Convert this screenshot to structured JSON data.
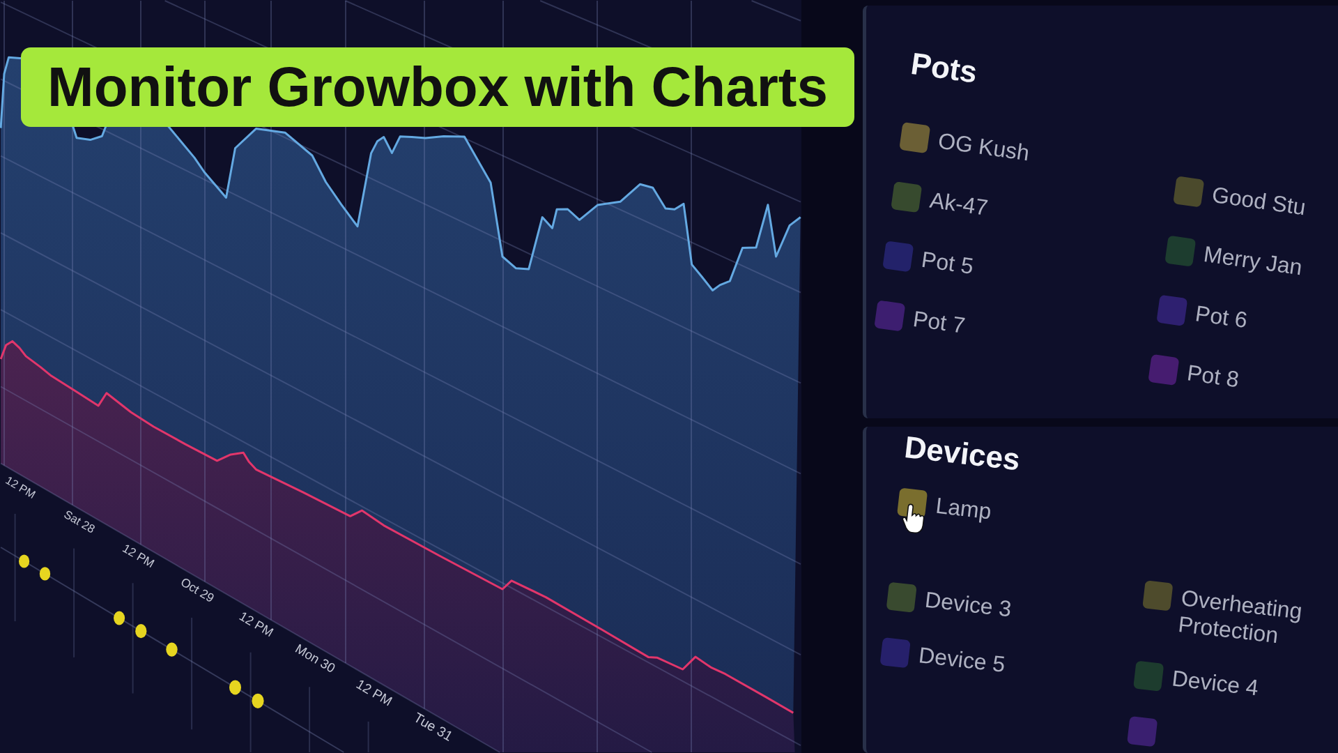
{
  "banner": {
    "title": "Monitor Growbox with Charts"
  },
  "chart": {
    "x_axis_labels": [
      "12 PM",
      "Sat 28",
      "12 PM",
      "Oct 29",
      "12 PM",
      "Mon 30",
      "12 PM",
      "Tue 31"
    ]
  },
  "pots": {
    "title": "Pots",
    "columns": [
      [
        {
          "label": "OG Kush",
          "color": "#6b5f35"
        },
        {
          "label": "Ak-47",
          "color": "#374a2e"
        },
        {
          "label": "Pot 5",
          "color": "#23226a"
        },
        {
          "label": "Pot 7",
          "color": "#3d1e70"
        }
      ],
      [
        {
          "label": "Good Stu",
          "color": "#4b4a2c"
        },
        {
          "label": "Merry Jan",
          "color": "#1d3d2f"
        },
        {
          "label": "Pot 6",
          "color": "#2e2070"
        },
        {
          "label": "Pot 8",
          "color": "#461c70"
        }
      ]
    ]
  },
  "devices": {
    "title": "Devices",
    "columns": [
      [
        {
          "label": "Lamp",
          "color": "#7a6e2e"
        },
        {
          "label": "Device 3",
          "color": "#394a2f"
        },
        {
          "label": "Device 5",
          "color": "#26206b"
        }
      ],
      [
        {
          "label": "Overheating Protection",
          "color": "#4e4b2c"
        },
        {
          "label": "Device 4",
          "color": "#1d3c2e"
        },
        {
          "color": "#3a1f70"
        }
      ]
    ]
  }
}
